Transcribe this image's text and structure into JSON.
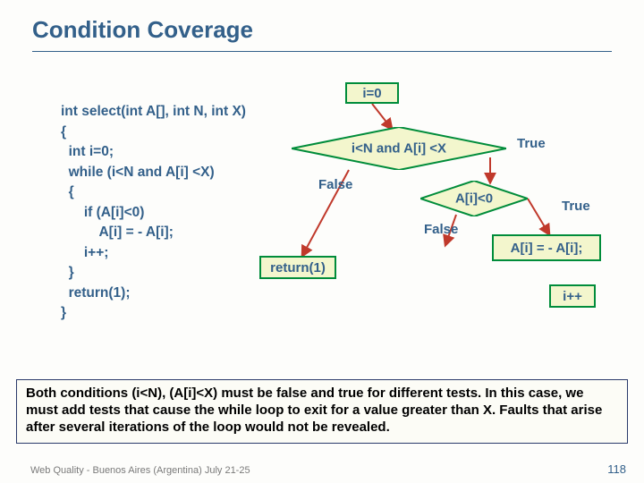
{
  "title": "Condition Coverage",
  "code_lines": [
    "int select(int A[], int N, int X)",
    "{",
    "  int i=0;",
    "  while (i<N and A[i] <X)",
    "  {",
    "      if (A[i]<0)",
    "          A[i] = - A[i];",
    "      i++;",
    "  }",
    "  return(1);",
    "}"
  ],
  "flow": {
    "init": "i=0",
    "cond": "i<N and A[i] <X",
    "cond_true": "True",
    "cond_false": "False",
    "ifcond": "A[i]<0",
    "if_true": "True",
    "if_false": "False",
    "assign": "A[i] = - A[i];",
    "incr": "i++",
    "ret": "return(1)"
  },
  "explain": "Both conditions (i<N), (A[i]<X) must be false and true for different tests.  In this case, we must add tests that cause the while loop to exit  for a value greater than X. Faults that arise after several iterations of the loop would not be revealed.",
  "footer": "Web Quality - Buenos Aires (Argentina) July 21-25",
  "page": "118"
}
